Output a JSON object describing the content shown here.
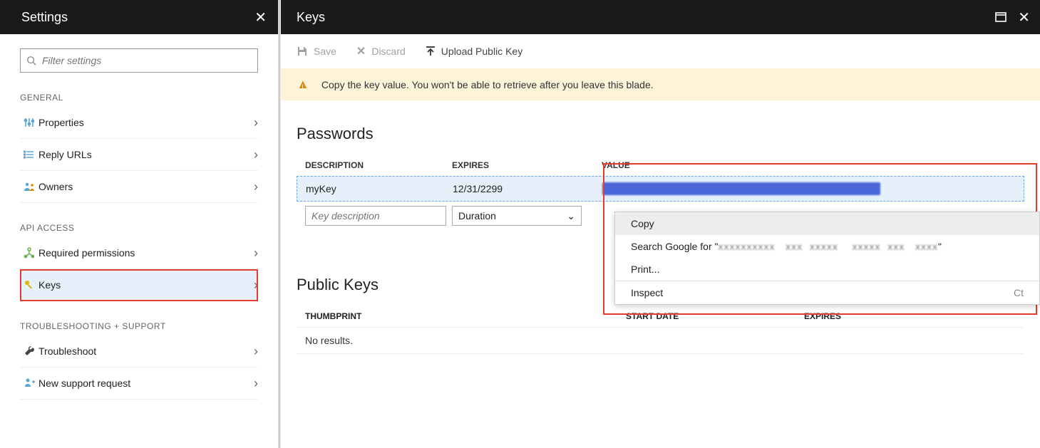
{
  "settings": {
    "title": "Settings",
    "search_placeholder": "Filter settings",
    "sections": {
      "general": {
        "label": "GENERAL"
      },
      "api": {
        "label": "API ACCESS"
      },
      "trouble": {
        "label": "TROUBLESHOOTING + SUPPORT"
      }
    },
    "items": {
      "properties": "Properties",
      "reply_urls": "Reply URLs",
      "owners": "Owners",
      "required_permissions": "Required permissions",
      "keys": "Keys",
      "troubleshoot": "Troubleshoot",
      "new_support": "New support request"
    }
  },
  "keys": {
    "title": "Keys",
    "toolbar": {
      "save": "Save",
      "discard": "Discard",
      "upload": "Upload Public Key"
    },
    "banner": "Copy the key value. You won't be able to retrieve after you leave this blade.",
    "passwords": {
      "heading": "Passwords",
      "cols": {
        "desc": "DESCRIPTION",
        "exp": "EXPIRES",
        "val": "VALUE"
      },
      "row": {
        "desc": "myKey",
        "exp": "12/31/2299"
      },
      "new_desc_placeholder": "Key description",
      "duration_label": "Duration"
    },
    "public": {
      "heading": "Public Keys",
      "cols": {
        "thumb": "THUMBPRINT",
        "start": "START DATE",
        "exp": "EXPIRES"
      },
      "empty": "No results."
    }
  },
  "context_menu": {
    "copy": "Copy",
    "search_prefix": "Search Google for \"",
    "search_suffix": "\"",
    "print": "Print...",
    "inspect": "Inspect",
    "inspect_shortcut": "Ct"
  }
}
